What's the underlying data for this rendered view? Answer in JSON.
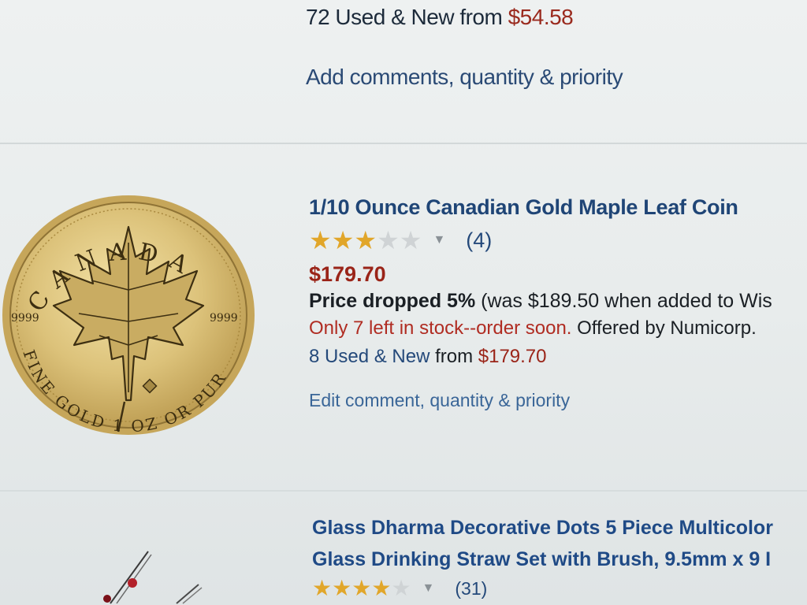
{
  "previous_item": {
    "used_new_prefix": "72 Used & New from ",
    "used_new_price": "$54.58",
    "add_comments": "Add comments, quantity & priority"
  },
  "item": {
    "image_alt": "Canadian Gold Maple Leaf coin",
    "coin_text_top": "CANADA",
    "coin_text_bottom": "FINE GOLD 1 OZ OR PUR",
    "coin_text_left": "9999",
    "coin_text_right": "9999",
    "title": "1/10 Ounce Canadian Gold Maple Leaf Coin",
    "rating": 3,
    "rating_max": 5,
    "review_count": "(4)",
    "price": "$179.70",
    "price_drop_bold": "Price dropped 5%",
    "price_drop_rest": " (was $189.50 when added to Wis",
    "stock_red": "Only 7 left in stock--order soon.",
    "offered_by": " Offered by Numicorp.",
    "used_new_link": "8 Used & New",
    "used_new_from": " from ",
    "used_new_price": "$179.70",
    "edit_comment": "Edit comment, quantity & priority"
  },
  "next_item": {
    "title_line1": "Glass Dharma Decorative Dots 5 Piece Multicolor",
    "title_line2": "Glass Drinking Straw Set with Brush, 9.5mm x 9 I",
    "rating": 4,
    "review_count": "(31)"
  },
  "colors": {
    "link": "#1f4576",
    "price": "#9a2418",
    "star": "#e1a62a",
    "star_empty": "#cfd3d5"
  }
}
